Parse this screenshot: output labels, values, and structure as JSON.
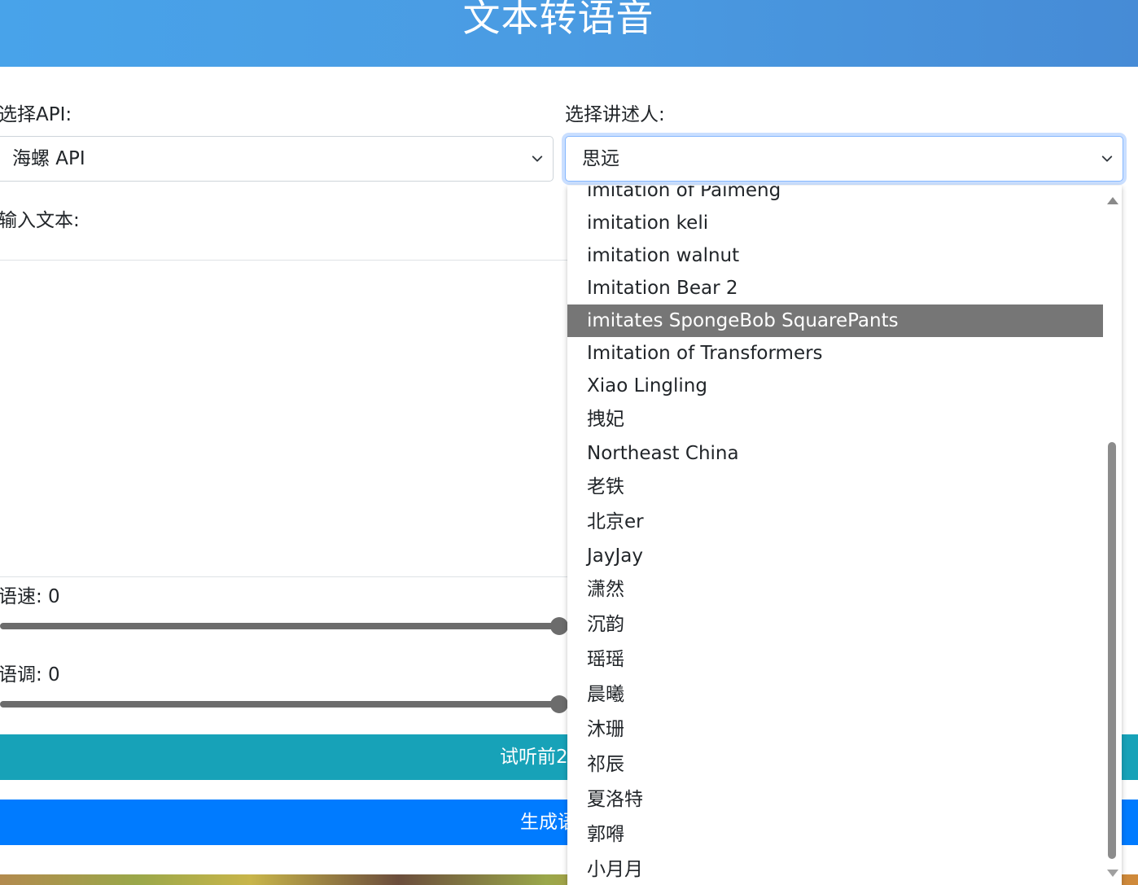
{
  "header": {
    "title": "文本转语音"
  },
  "form": {
    "api_label": "选择API:",
    "api_selected": "海螺 API",
    "narrator_label": "选择讲述人:",
    "narrator_selected": "思远",
    "text_label": "输入文本:",
    "text_value": "",
    "speed_label": "语速: 0",
    "speed_value": 0,
    "pitch_label": "语调: 0",
    "pitch_value": 0,
    "listen_button": "试听前2",
    "generate_button": "生成语"
  },
  "narrator_dropdown": {
    "options": [
      "imitation of Paimeng",
      "imitation keli",
      "imitation walnut",
      "Imitation Bear 2",
      "imitates SpongeBob SquarePants",
      "Imitation of Transformers",
      "Xiao Lingling",
      "拽妃",
      "Northeast China",
      "老铁",
      "北京er",
      "JayJay",
      "潇然",
      "沉韵",
      "瑶瑶",
      "晨曦",
      "沐珊",
      "祁辰",
      "夏洛特",
      "郭嘚",
      "小月月"
    ],
    "highlighted_index": 4
  },
  "colors": {
    "header_gradient_start": "#48a3ea",
    "header_gradient_end": "#468bd6",
    "listen_button_bg": "#17a2b8",
    "generate_button_bg": "#007bff",
    "highlight_bg": "#767676",
    "focus_ring": "#86b7fe"
  }
}
